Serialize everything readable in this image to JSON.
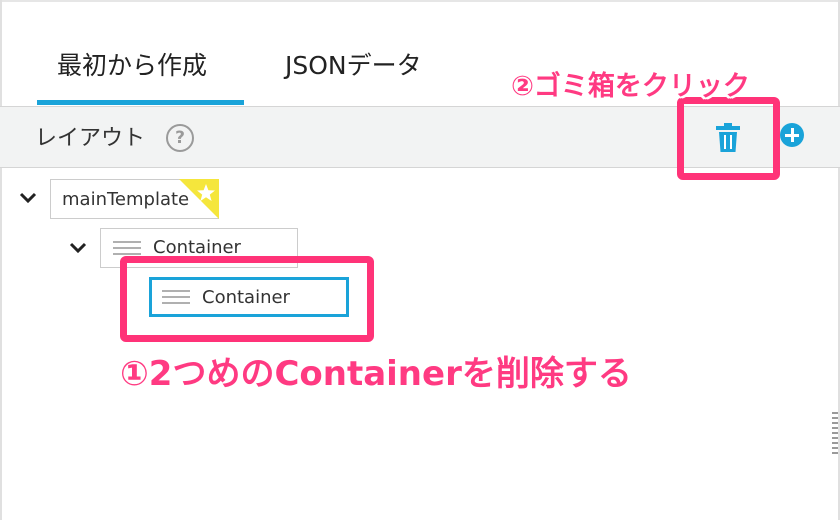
{
  "tabs": [
    {
      "label": "最初から作成",
      "active": true
    },
    {
      "label": "JSONデータ",
      "active": false
    }
  ],
  "panel": {
    "title": "レイアウト",
    "help_glyph": "?"
  },
  "tree": {
    "root": {
      "label": "mainTemplate"
    },
    "child": {
      "label": "Container"
    },
    "grandchild": {
      "label": "Container",
      "selected": true
    }
  },
  "annotations": {
    "step1": "①2つめのContainerを削除する",
    "step2": "②ゴミ箱をクリック"
  },
  "colors": {
    "accent": "#1aa3d9",
    "highlight": "#ff3378",
    "annotation_text": "#ff3a82",
    "star": "#f5e63c"
  }
}
